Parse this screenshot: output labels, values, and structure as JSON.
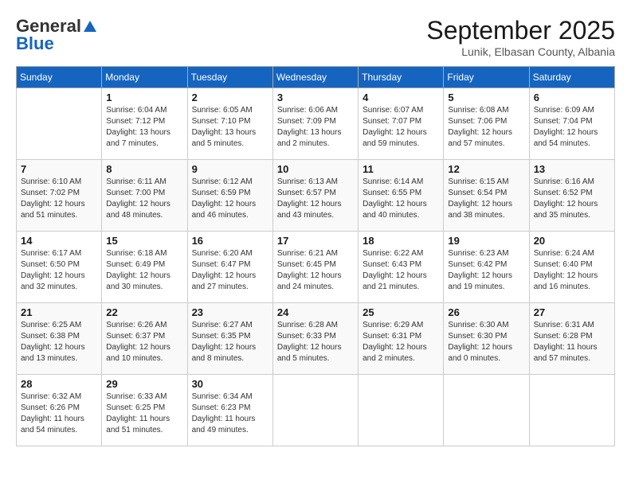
{
  "header": {
    "logo_general": "General",
    "logo_blue": "Blue",
    "month": "September 2025",
    "location": "Lunik, Elbasan County, Albania"
  },
  "calendar": {
    "days_of_week": [
      "Sunday",
      "Monday",
      "Tuesday",
      "Wednesday",
      "Thursday",
      "Friday",
      "Saturday"
    ],
    "weeks": [
      [
        {
          "day": "",
          "sunrise": "",
          "sunset": "",
          "daylight": ""
        },
        {
          "day": "1",
          "sunrise": "Sunrise: 6:04 AM",
          "sunset": "Sunset: 7:12 PM",
          "daylight": "Daylight: 13 hours and 7 minutes."
        },
        {
          "day": "2",
          "sunrise": "Sunrise: 6:05 AM",
          "sunset": "Sunset: 7:10 PM",
          "daylight": "Daylight: 13 hours and 5 minutes."
        },
        {
          "day": "3",
          "sunrise": "Sunrise: 6:06 AM",
          "sunset": "Sunset: 7:09 PM",
          "daylight": "Daylight: 13 hours and 2 minutes."
        },
        {
          "day": "4",
          "sunrise": "Sunrise: 6:07 AM",
          "sunset": "Sunset: 7:07 PM",
          "daylight": "Daylight: 12 hours and 59 minutes."
        },
        {
          "day": "5",
          "sunrise": "Sunrise: 6:08 AM",
          "sunset": "Sunset: 7:06 PM",
          "daylight": "Daylight: 12 hours and 57 minutes."
        },
        {
          "day": "6",
          "sunrise": "Sunrise: 6:09 AM",
          "sunset": "Sunset: 7:04 PM",
          "daylight": "Daylight: 12 hours and 54 minutes."
        }
      ],
      [
        {
          "day": "7",
          "sunrise": "Sunrise: 6:10 AM",
          "sunset": "Sunset: 7:02 PM",
          "daylight": "Daylight: 12 hours and 51 minutes."
        },
        {
          "day": "8",
          "sunrise": "Sunrise: 6:11 AM",
          "sunset": "Sunset: 7:00 PM",
          "daylight": "Daylight: 12 hours and 48 minutes."
        },
        {
          "day": "9",
          "sunrise": "Sunrise: 6:12 AM",
          "sunset": "Sunset: 6:59 PM",
          "daylight": "Daylight: 12 hours and 46 minutes."
        },
        {
          "day": "10",
          "sunrise": "Sunrise: 6:13 AM",
          "sunset": "Sunset: 6:57 PM",
          "daylight": "Daylight: 12 hours and 43 minutes."
        },
        {
          "day": "11",
          "sunrise": "Sunrise: 6:14 AM",
          "sunset": "Sunset: 6:55 PM",
          "daylight": "Daylight: 12 hours and 40 minutes."
        },
        {
          "day": "12",
          "sunrise": "Sunrise: 6:15 AM",
          "sunset": "Sunset: 6:54 PM",
          "daylight": "Daylight: 12 hours and 38 minutes."
        },
        {
          "day": "13",
          "sunrise": "Sunrise: 6:16 AM",
          "sunset": "Sunset: 6:52 PM",
          "daylight": "Daylight: 12 hours and 35 minutes."
        }
      ],
      [
        {
          "day": "14",
          "sunrise": "Sunrise: 6:17 AM",
          "sunset": "Sunset: 6:50 PM",
          "daylight": "Daylight: 12 hours and 32 minutes."
        },
        {
          "day": "15",
          "sunrise": "Sunrise: 6:18 AM",
          "sunset": "Sunset: 6:49 PM",
          "daylight": "Daylight: 12 hours and 30 minutes."
        },
        {
          "day": "16",
          "sunrise": "Sunrise: 6:20 AM",
          "sunset": "Sunset: 6:47 PM",
          "daylight": "Daylight: 12 hours and 27 minutes."
        },
        {
          "day": "17",
          "sunrise": "Sunrise: 6:21 AM",
          "sunset": "Sunset: 6:45 PM",
          "daylight": "Daylight: 12 hours and 24 minutes."
        },
        {
          "day": "18",
          "sunrise": "Sunrise: 6:22 AM",
          "sunset": "Sunset: 6:43 PM",
          "daylight": "Daylight: 12 hours and 21 minutes."
        },
        {
          "day": "19",
          "sunrise": "Sunrise: 6:23 AM",
          "sunset": "Sunset: 6:42 PM",
          "daylight": "Daylight: 12 hours and 19 minutes."
        },
        {
          "day": "20",
          "sunrise": "Sunrise: 6:24 AM",
          "sunset": "Sunset: 6:40 PM",
          "daylight": "Daylight: 12 hours and 16 minutes."
        }
      ],
      [
        {
          "day": "21",
          "sunrise": "Sunrise: 6:25 AM",
          "sunset": "Sunset: 6:38 PM",
          "daylight": "Daylight: 12 hours and 13 minutes."
        },
        {
          "day": "22",
          "sunrise": "Sunrise: 6:26 AM",
          "sunset": "Sunset: 6:37 PM",
          "daylight": "Daylight: 12 hours and 10 minutes."
        },
        {
          "day": "23",
          "sunrise": "Sunrise: 6:27 AM",
          "sunset": "Sunset: 6:35 PM",
          "daylight": "Daylight: 12 hours and 8 minutes."
        },
        {
          "day": "24",
          "sunrise": "Sunrise: 6:28 AM",
          "sunset": "Sunset: 6:33 PM",
          "daylight": "Daylight: 12 hours and 5 minutes."
        },
        {
          "day": "25",
          "sunrise": "Sunrise: 6:29 AM",
          "sunset": "Sunset: 6:31 PM",
          "daylight": "Daylight: 12 hours and 2 minutes."
        },
        {
          "day": "26",
          "sunrise": "Sunrise: 6:30 AM",
          "sunset": "Sunset: 6:30 PM",
          "daylight": "Daylight: 12 hours and 0 minutes."
        },
        {
          "day": "27",
          "sunrise": "Sunrise: 6:31 AM",
          "sunset": "Sunset: 6:28 PM",
          "daylight": "Daylight: 11 hours and 57 minutes."
        }
      ],
      [
        {
          "day": "28",
          "sunrise": "Sunrise: 6:32 AM",
          "sunset": "Sunset: 6:26 PM",
          "daylight": "Daylight: 11 hours and 54 minutes."
        },
        {
          "day": "29",
          "sunrise": "Sunrise: 6:33 AM",
          "sunset": "Sunset: 6:25 PM",
          "daylight": "Daylight: 11 hours and 51 minutes."
        },
        {
          "day": "30",
          "sunrise": "Sunrise: 6:34 AM",
          "sunset": "Sunset: 6:23 PM",
          "daylight": "Daylight: 11 hours and 49 minutes."
        },
        {
          "day": "",
          "sunrise": "",
          "sunset": "",
          "daylight": ""
        },
        {
          "day": "",
          "sunrise": "",
          "sunset": "",
          "daylight": ""
        },
        {
          "day": "",
          "sunrise": "",
          "sunset": "",
          "daylight": ""
        },
        {
          "day": "",
          "sunrise": "",
          "sunset": "",
          "daylight": ""
        }
      ]
    ]
  }
}
